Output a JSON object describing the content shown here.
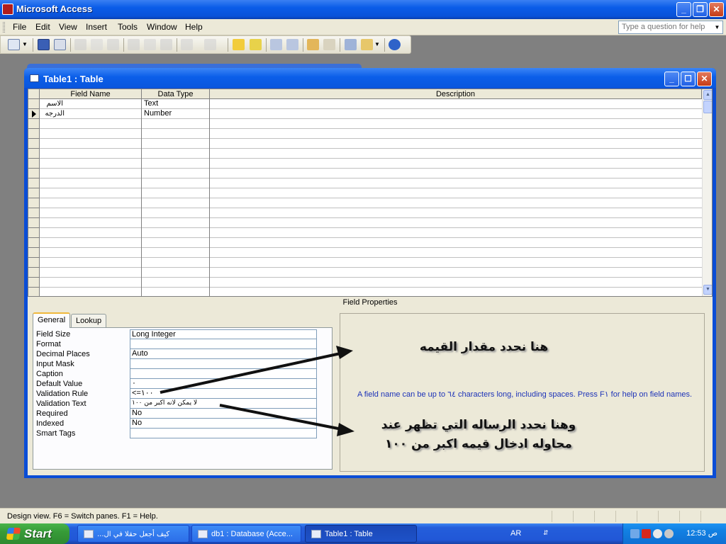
{
  "app": {
    "title": "Microsoft Access"
  },
  "menu": {
    "items": [
      "File",
      "Edit",
      "View",
      "Insert",
      "Tools",
      "Window",
      "Help"
    ],
    "help_placeholder": "Type a question for help"
  },
  "table_window": {
    "title": "Table1 : Table"
  },
  "grid": {
    "columns": [
      "Field Name",
      "Data Type",
      "Description"
    ],
    "rows": [
      {
        "field_name": "الاسم",
        "data_type": "Text",
        "description": ""
      },
      {
        "field_name": "الدرجه",
        "data_type": "Number",
        "description": ""
      }
    ]
  },
  "field_properties": {
    "title": "Field Properties",
    "tabs": [
      "General",
      "Lookup"
    ],
    "active_tab": "General",
    "rows": [
      {
        "label": "Field Size",
        "value": "Long Integer"
      },
      {
        "label": "Format",
        "value": ""
      },
      {
        "label": "Decimal Places",
        "value": "Auto"
      },
      {
        "label": "Input Mask",
        "value": ""
      },
      {
        "label": "Caption",
        "value": ""
      },
      {
        "label": "Default Value",
        "value": "٠"
      },
      {
        "label": "Validation Rule",
        "value": "<=١٠٠"
      },
      {
        "label": "Validation Text",
        "value": "لا يمكن لانه اكبر من ١٠٠"
      },
      {
        "label": "Required",
        "value": "No"
      },
      {
        "label": "Indexed",
        "value": "No"
      },
      {
        "label": "Smart Tags",
        "value": ""
      }
    ],
    "help_text": "A field name can be up to ٦٤ characters long, including spaces.  Press F١ for help on field names."
  },
  "annotations": {
    "note1": "هنا نحدد مقدار القيمه",
    "note2_line1": "وهنا نحدد الرساله التي تظهر عند",
    "note2_line2": "محاوله ادخال قيمه اكبر من ١٠٠"
  },
  "status_bar": {
    "text": "Design view.  F6 = Switch panes.  F1 = Help."
  },
  "taskbar": {
    "start": "Start",
    "tasks": [
      {
        "label": "كيف أجعل حقلا في ال...",
        "active": false
      },
      {
        "label": "db1 : Database (Acce...",
        "active": false
      },
      {
        "label": "Table1 : Table",
        "active": true
      }
    ],
    "language": "AR",
    "clock": "12:53 ص"
  },
  "colors": {
    "title_blue": "#0a5ce8",
    "window_face": "#ece9d8",
    "help_text_blue": "#1d33b8",
    "start_green": "#379b38"
  }
}
